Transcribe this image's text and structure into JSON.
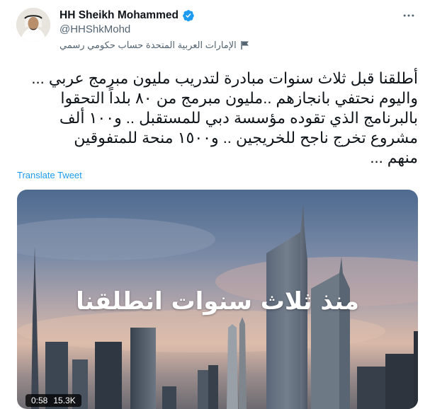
{
  "tweet": {
    "display_name": "HH Sheikh Mohammed",
    "handle": "@HHShkMohd",
    "gov_label": "الإمارات العربية المتحدة حساب حكومي رسمي",
    "text": "أطلقنا قبل ثلاث سنوات مبادرة لتدريب مليون مبرمج عربي ...\nواليوم نحتفي بانجازهم ..مليون مبرمج من ٨٠ بلداً التحقوا\nبالبرنامج الذي تقوده مؤسسة دبي للمستقبل .. و١٠٠ ألف\nمشروع تخرج ناجح للخريجين .. و١٥٠٠ منحة للمتفوقين\nمنهم ...",
    "translate_label": "Translate Tweet",
    "media_overlay_text": "منذ ثلاث سنوات انطلقنا",
    "video_time": "0:58",
    "video_views": "15.3K"
  },
  "icons": {
    "verified": "verified-badge-icon",
    "more": "more-options-icon",
    "gov_flag": "flag-icon"
  },
  "colors": {
    "accent": "#1d9bf0",
    "text": "#0f1419",
    "secondary": "#536471"
  }
}
